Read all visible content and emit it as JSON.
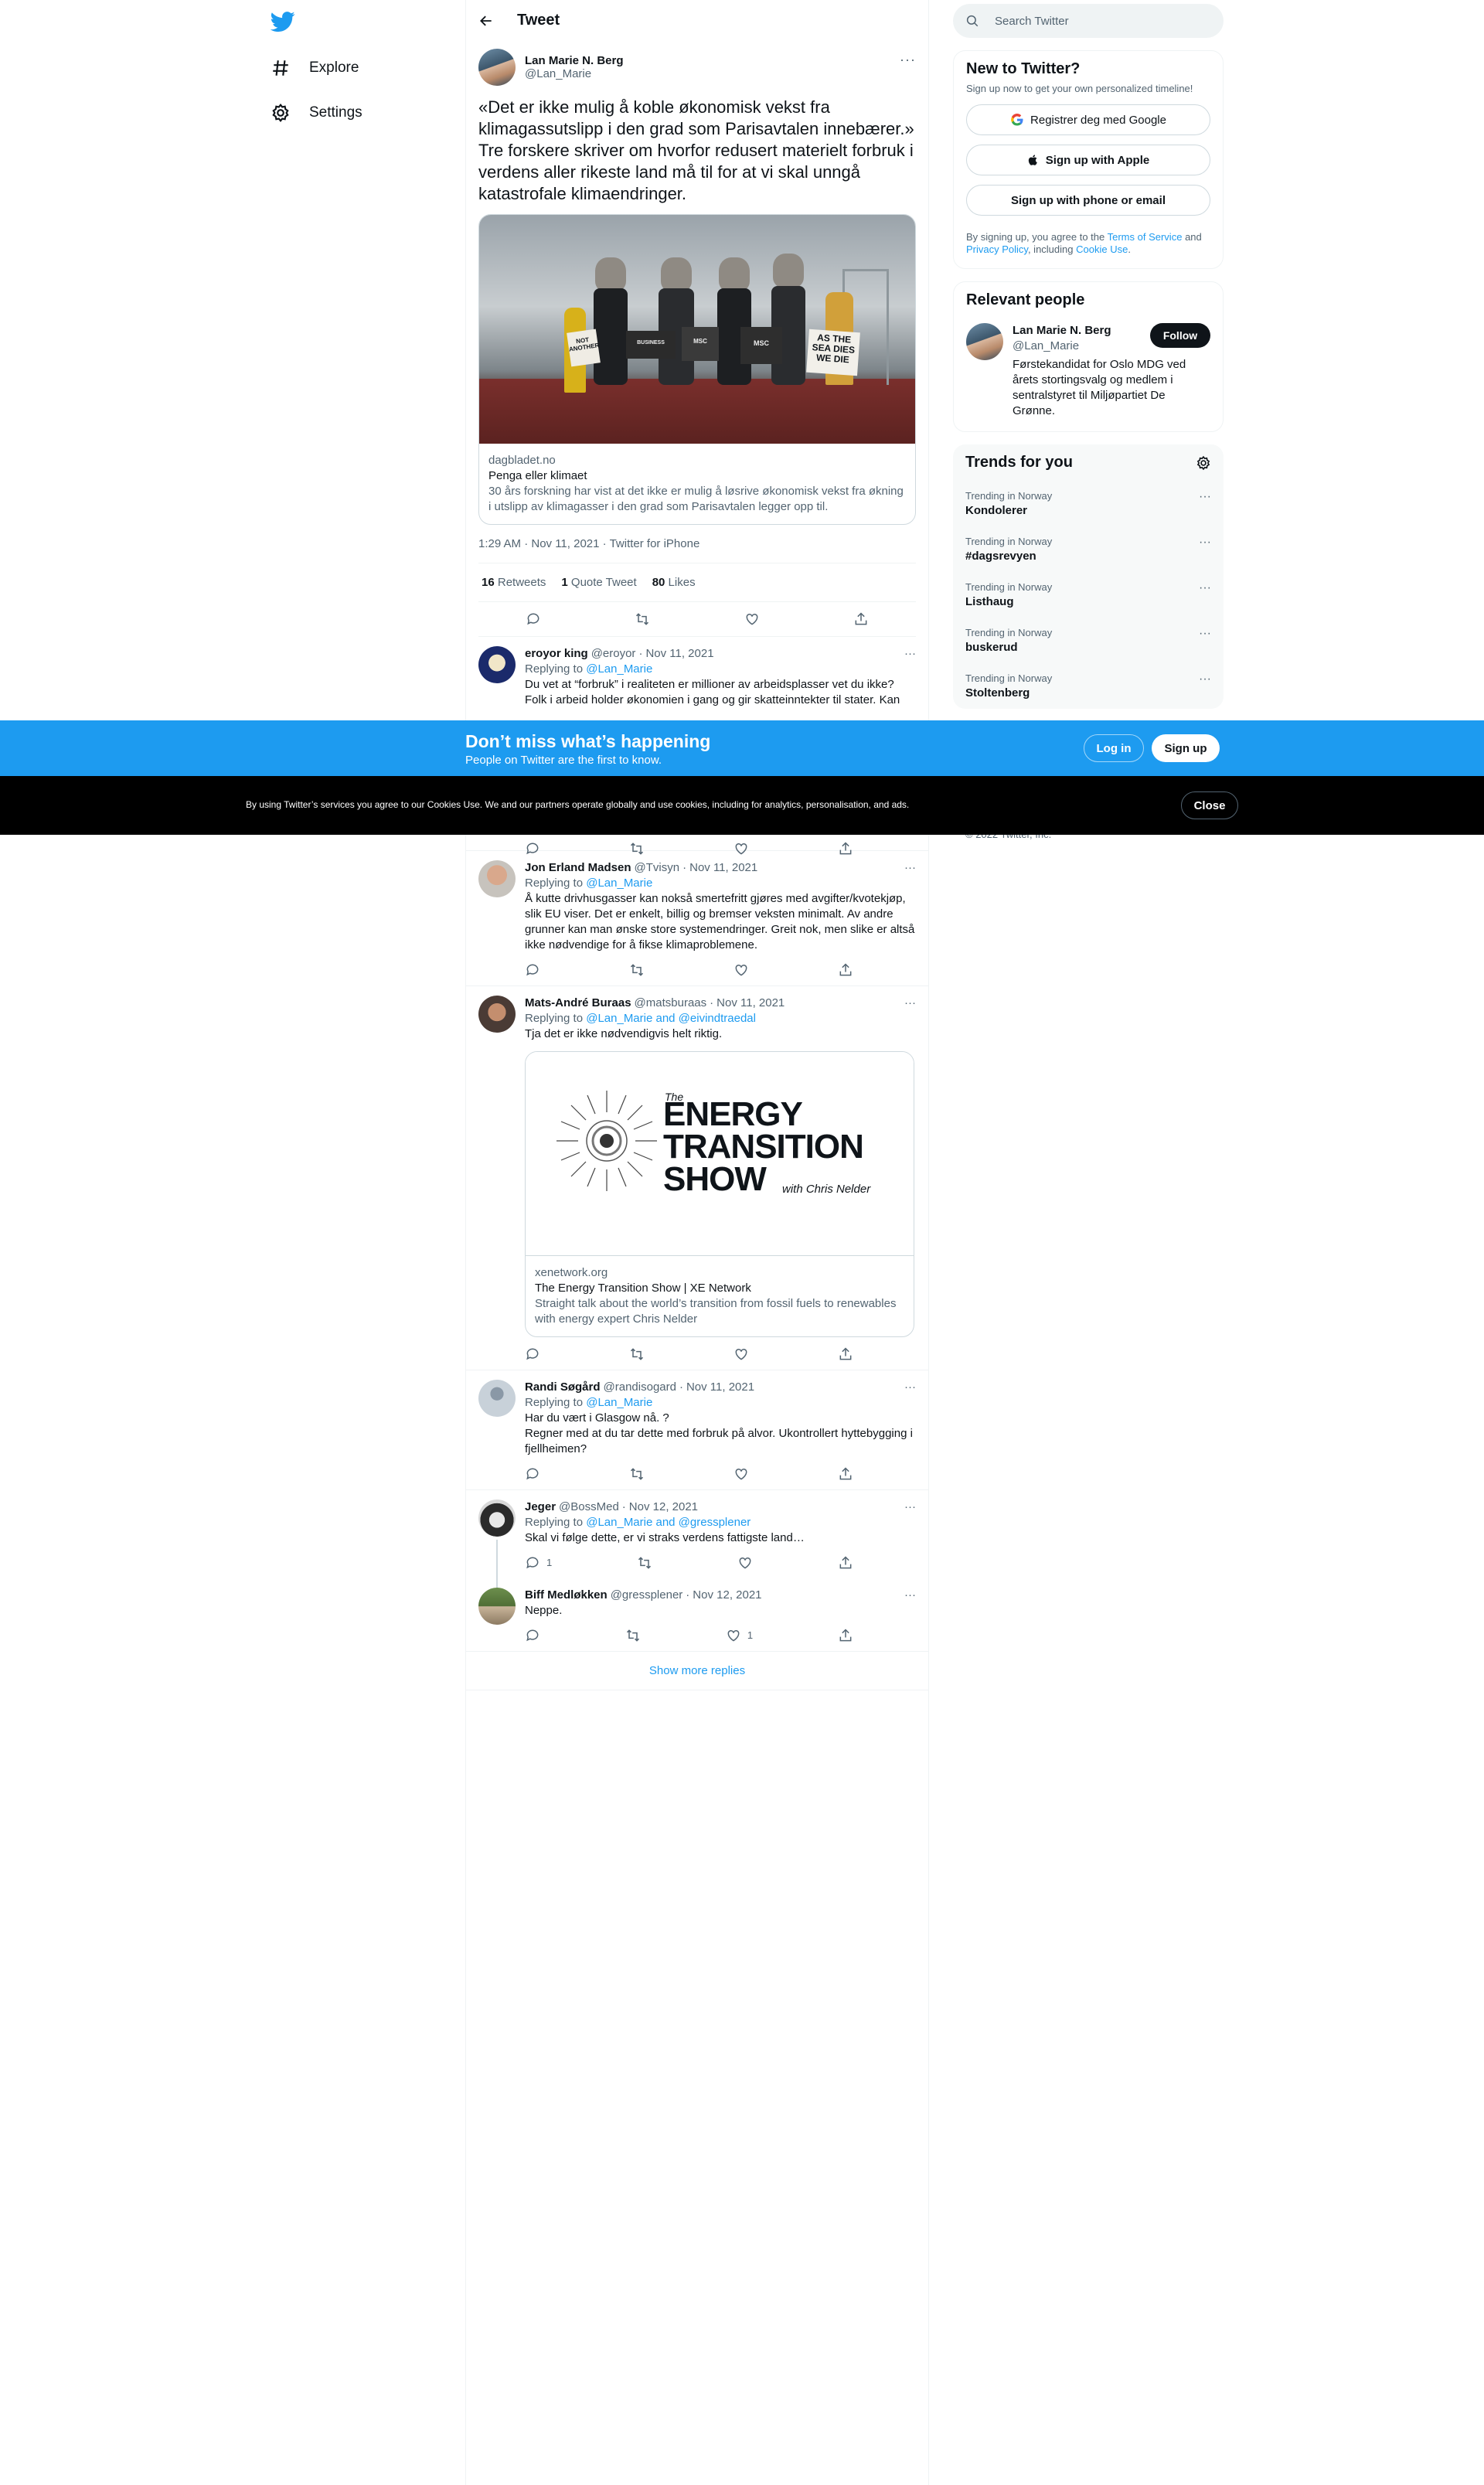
{
  "nav": {
    "explore": "Explore",
    "settings": "Settings"
  },
  "header": {
    "title": "Tweet"
  },
  "tweet": {
    "author_name": "Lan Marie N. Berg",
    "author_handle": "@Lan_Marie",
    "text": "«Det er ikke mulig å koble økonomisk vekst fra klimagassutslipp i den grad som Parisavtalen innebærer.» Tre forskere skriver om hvorfor redusert materielt forbruk i verdens aller rikeste land må til for at vi skal unngå katastrofale klimaendringer.",
    "card": {
      "domain": "dagbladet.no",
      "title": "Penga eller klimaet",
      "description": "30 års forskning har vist at det ikke er mulig å løsrive økonomisk vekst fra økning i utslipp av klimagasser i den grad som Parisavtalen legger opp til.",
      "image_signs": [
        "BUSINESS",
        "NOT ANOTHER",
        "MSC",
        "AS THE SEA DIES WE DIE"
      ]
    },
    "timestamp": "1:29 AM · Nov 11, 2021",
    "source": "Twitter for iPhone",
    "retweets_count": "16",
    "retweets_label": "Retweets",
    "quotes_count": "1",
    "quotes_label": "Quote Tweet",
    "likes_count": "80",
    "likes_label": "Likes"
  },
  "replies": [
    {
      "name": "eroyor king",
      "handle": "@eroyor",
      "date": "Nov 11, 2021",
      "replying_prefix": "Replying to",
      "replying_to": "@Lan_Marie",
      "text": "Du vet at “forbruk” i realiteten er millioner av arbeidsplasser vet du ikke? Folk i arbeid holder økonomien i gang og gir skatteinntekter til stater. Kan"
    },
    {
      "name": "Jon Erland Madsen",
      "handle": "@Tvisyn",
      "date": "Nov 11, 2021",
      "replying_prefix": "Replying to",
      "replying_to": "@Lan_Marie",
      "text": "Å kutte drivhusgasser kan nokså smertefritt gjøres med avgifter/kvotekjøp, slik EU viser. Det er enkelt, billig og bremser veksten minimalt. Av andre grunner kan man ønske store systemendringer. Greit nok, men slike er altså ikke nødvendige for å fikse klimaproblemene."
    },
    {
      "name": "Mats-André Buraas",
      "handle": "@matsburaas",
      "date": "Nov 11, 2021",
      "replying_prefix": "Replying to",
      "replying_to": "@Lan_Marie and @eivindtraedal",
      "text": "Tja det er ikke nødvendigvis helt riktig.",
      "card": {
        "logo_the": "The",
        "logo_line1": "ENERGY",
        "logo_line2": "TRANSITION",
        "logo_line3": "SHOW",
        "logo_with": "with Chris Nelder",
        "domain": "xenetwork.org",
        "title": "The Energy Transition Show | XE Network",
        "description": "Straight talk about the world’s transition from fossil fuels to renewables with energy expert Chris Nelder"
      }
    },
    {
      "name": "Randi Søgård",
      "handle": "@randisogard",
      "date": "Nov 11, 2021",
      "replying_prefix": "Replying to",
      "replying_to": "@Lan_Marie",
      "text_line1": "Har du vært i Glasgow nå. ?",
      "text_line2": "Regner med at du tar dette med forbruk på alvor. Ukontrollert  hyttebygging i fjellheimen?"
    },
    {
      "name": "Jeger",
      "handle": "@BossMed",
      "date": "Nov 12, 2021",
      "replying_prefix": "Replying to",
      "replying_to": "@Lan_Marie and @gressplener",
      "text": "Skal vi følge dette, er vi straks verdens fattigste land…",
      "reply_count": "1"
    },
    {
      "name": "Biff Medløkken",
      "handle": "@gressplener",
      "date": "Nov 12, 2021",
      "text": "Neppe.",
      "like_count": "1"
    }
  ],
  "show_more": "Show more replies",
  "sidebar": {
    "search_placeholder": "Search Twitter",
    "new_title": "New to Twitter?",
    "new_sub": "Sign up now to get your own personalized timeline!",
    "google_btn": "Registrer deg med Google",
    "apple_btn": "Sign up with Apple",
    "phone_btn": "Sign up with phone or email",
    "legal_prefix": "By signing up, you agree to the",
    "terms": "Terms of Service",
    "and": "and",
    "privacy": "Privacy Policy",
    "including": ", including",
    "cookie": "Cookie Use",
    "relevant_title": "Relevant people",
    "person_name": "Lan Marie N. Berg",
    "person_handle": "@Lan_Marie",
    "follow_btn": "Follow",
    "person_bio": "Førstekandidat for Oslo MDG ved årets stortingsvalg og medlem i sentralstyret til Miljøpartiet De Grønne.",
    "trends_title": "Trends for you",
    "trends": [
      {
        "context": "Trending in Norway",
        "name": "Kondolerer"
      },
      {
        "context": "Trending in Norway",
        "name": "#dagsrevyen"
      },
      {
        "context": "Trending in Norway",
        "name": "Listhaug"
      },
      {
        "context": "Trending in Norway",
        "name": "buskerud"
      },
      {
        "context": "Trending in Norway",
        "name": "Stoltenberg"
      }
    ],
    "copyright": "© 2022 Twitter, Inc."
  },
  "signup_bar": {
    "title": "Don’t miss what’s happening",
    "subtitle": "People on Twitter are the first to know.",
    "login": "Log in",
    "signup": "Sign up"
  },
  "cookie_bar": {
    "text": "By using Twitter’s services you agree to our Cookies Use. We and our partners operate globally and use cookies, including for analytics, personalisation, and ads.",
    "close": "Close"
  },
  "colors": {
    "accent": "#1d9bf0",
    "text": "#0f1419",
    "secondary": "#536471",
    "cookie_bg": "#000000"
  }
}
